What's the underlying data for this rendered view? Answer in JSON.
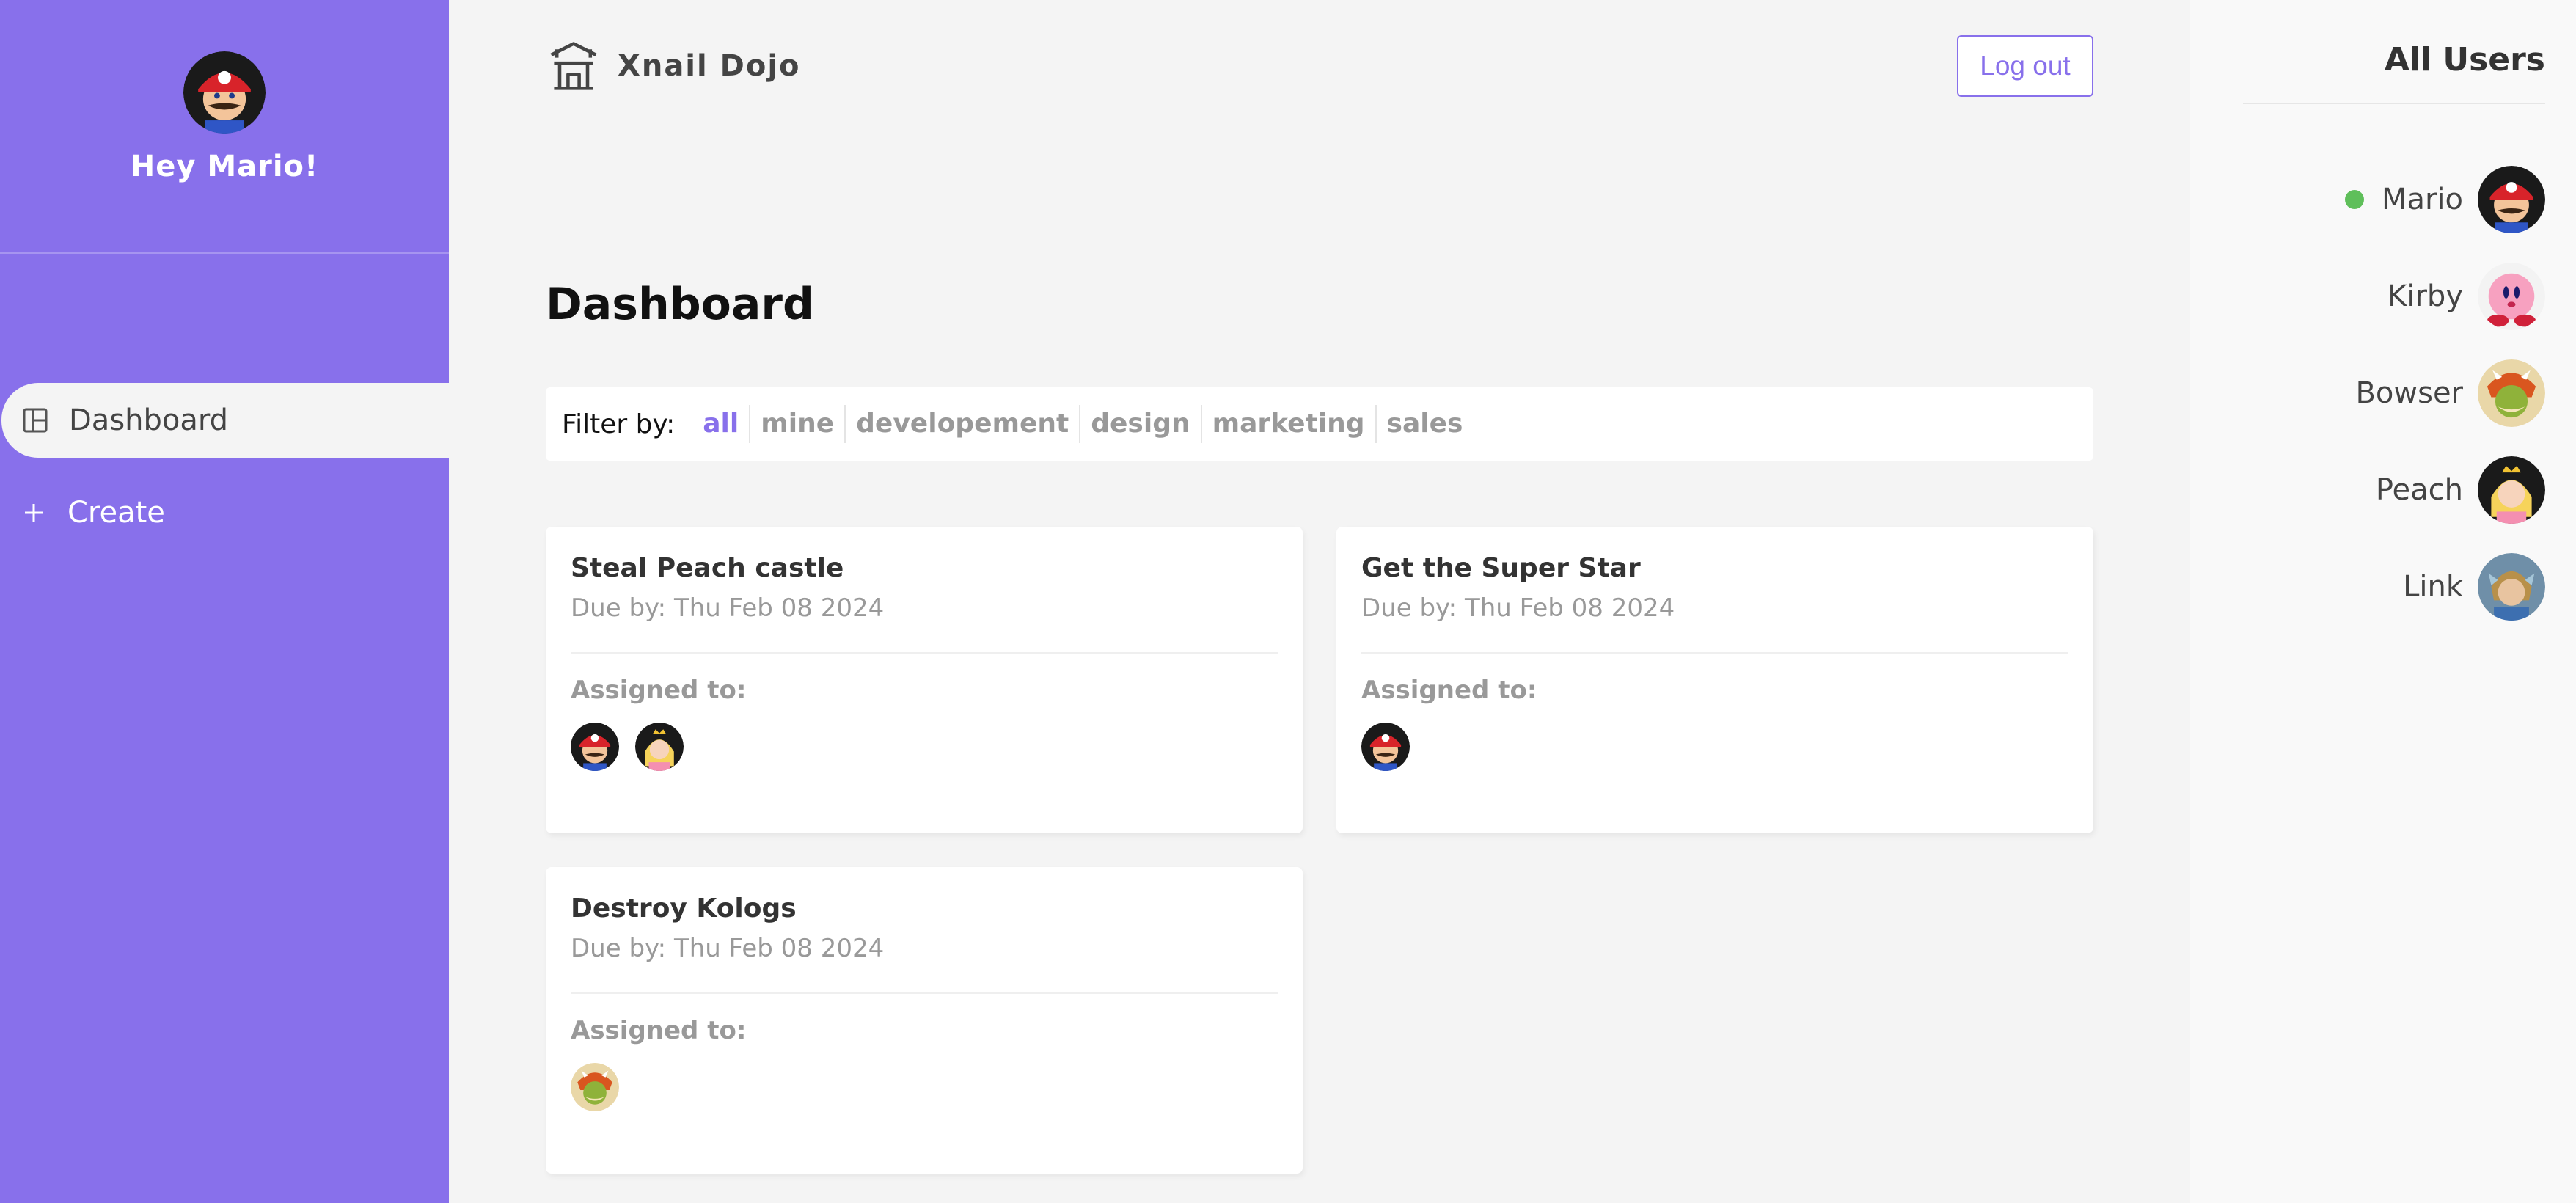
{
  "app": {
    "brand_name": "Xnail Dojo",
    "logout_label": "Log out",
    "accent": "#8870eb"
  },
  "sidebar": {
    "greeting": "Hey Mario!",
    "nav": [
      {
        "label": "Dashboard",
        "icon": "layout-icon",
        "active": true
      },
      {
        "label": "Create",
        "icon": "plus-icon",
        "active": false
      }
    ]
  },
  "main": {
    "title": "Dashboard",
    "filter": {
      "label": "Filter by:",
      "options": [
        "all",
        "mine",
        "developement",
        "design",
        "marketing",
        "sales"
      ],
      "selected": "all"
    },
    "projects": [
      {
        "title": "Steal Peach castle",
        "due": "Due by: Thu Feb 08 2024",
        "assigned_label": "Assigned to:",
        "assigned": [
          "Mario",
          "Peach"
        ]
      },
      {
        "title": "Get the Super Star",
        "due": "Due by: Thu Feb 08 2024",
        "assigned_label": "Assigned to:",
        "assigned": [
          "Mario"
        ]
      },
      {
        "title": "Destroy Kologs",
        "due": "Due by: Thu Feb 08 2024",
        "assigned_label": "Assigned to:",
        "assigned": [
          "Bowser"
        ]
      }
    ]
  },
  "users_panel": {
    "title": "All Users",
    "users": [
      {
        "name": "Mario",
        "online": true
      },
      {
        "name": "Kirby",
        "online": false
      },
      {
        "name": "Bowser",
        "online": false
      },
      {
        "name": "Peach",
        "online": false
      },
      {
        "name": "Link",
        "online": false
      }
    ],
    "online_color": "#5fbf5a"
  }
}
